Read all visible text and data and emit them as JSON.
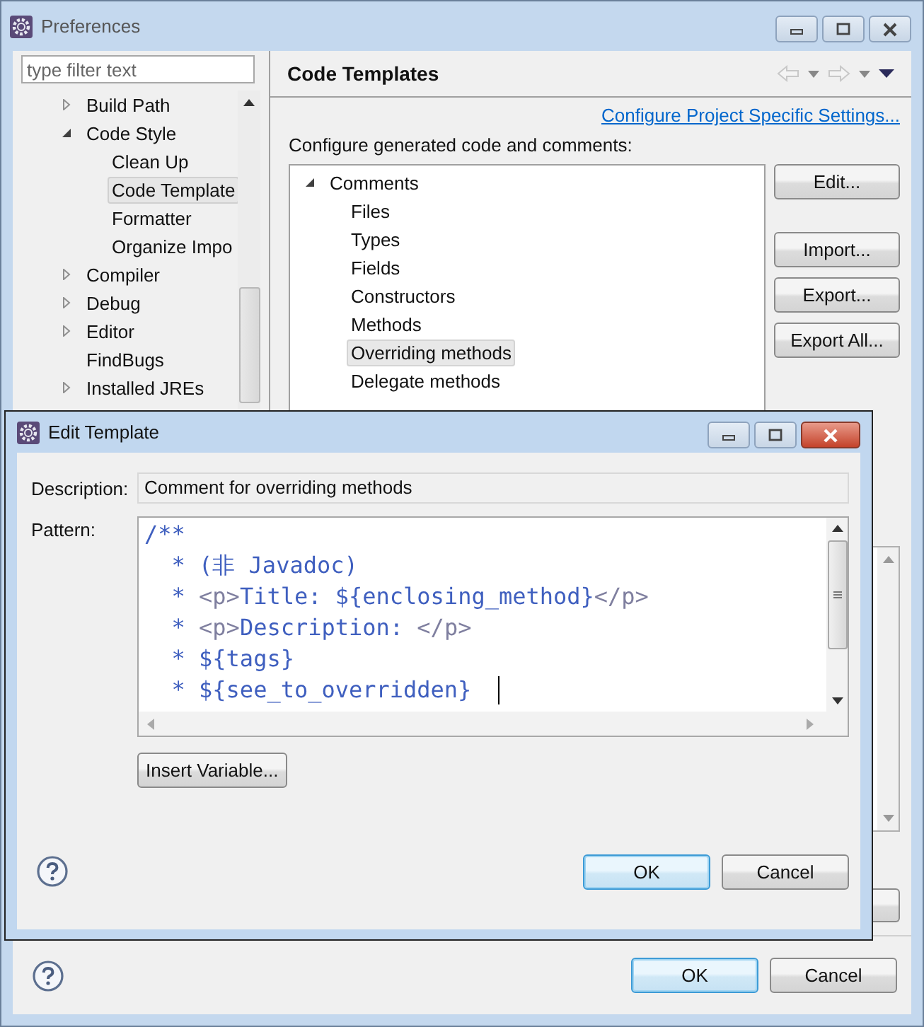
{
  "window": {
    "title": "Preferences"
  },
  "filter": {
    "placeholder": "type filter text"
  },
  "sidebar": {
    "items": [
      {
        "label": "Build Path",
        "kind": "branch",
        "expanded": false,
        "selected": false
      },
      {
        "label": "Code Style",
        "kind": "branch",
        "expanded": true,
        "selected": false,
        "children": [
          {
            "label": "Clean Up",
            "selected": false
          },
          {
            "label": "Code Template",
            "selected": true
          },
          {
            "label": "Formatter",
            "selected": false
          },
          {
            "label": "Organize Impo",
            "selected": false
          }
        ]
      },
      {
        "label": "Compiler",
        "kind": "branch",
        "expanded": false,
        "selected": false
      },
      {
        "label": "Debug",
        "kind": "branch",
        "expanded": false,
        "selected": false
      },
      {
        "label": "Editor",
        "kind": "branch",
        "expanded": false,
        "selected": false
      },
      {
        "label": "FindBugs",
        "kind": "leaf",
        "selected": false
      },
      {
        "label": "Installed JREs",
        "kind": "branch",
        "expanded": false,
        "selected": false
      }
    ]
  },
  "page": {
    "title": "Code Templates",
    "link": "Configure Project Specific Settings...",
    "intro": "Configure generated code and comments:",
    "templates": [
      {
        "label": "Comments",
        "expanded": true,
        "selected": false,
        "children": [
          {
            "label": "Files",
            "selected": false
          },
          {
            "label": "Types",
            "selected": false
          },
          {
            "label": "Fields",
            "selected": false
          },
          {
            "label": "Constructors",
            "selected": false
          },
          {
            "label": "Methods",
            "selected": false
          },
          {
            "label": "Overriding methods",
            "selected": true
          },
          {
            "label": "Delegate methods",
            "selected": false
          }
        ]
      }
    ],
    "buttons": [
      "Edit...",
      "Import...",
      "Export...",
      "Export All..."
    ]
  },
  "dialog": {
    "title": "Edit Template",
    "description_label": "Description:",
    "description": "Comment for overriding methods",
    "pattern_label": "Pattern:",
    "pattern": [
      [
        {
          "text": "/**",
          "kind": "text"
        }
      ],
      [
        {
          "text": "  * (非 Javadoc)",
          "kind": "text"
        }
      ],
      [
        {
          "text": "  * ",
          "kind": "text"
        },
        {
          "text": "<p>",
          "kind": "tag"
        },
        {
          "text": "Title: ${enclosing_method}",
          "kind": "text"
        },
        {
          "text": "</p>",
          "kind": "tag"
        }
      ],
      [
        {
          "text": "  * ",
          "kind": "text"
        },
        {
          "text": "<p>",
          "kind": "tag"
        },
        {
          "text": "Description: ",
          "kind": "text"
        },
        {
          "text": "</p>",
          "kind": "tag"
        }
      ],
      [
        {
          "text": "  * ${tags}",
          "kind": "text"
        }
      ],
      [
        {
          "text": "  * ${see_to_overridden} ",
          "kind": "text"
        }
      ]
    ],
    "insert_button": "Insert Variable...",
    "ok": "OK",
    "cancel": "Cancel"
  },
  "footer": {
    "ok": "OK",
    "cancel": "Cancel"
  }
}
